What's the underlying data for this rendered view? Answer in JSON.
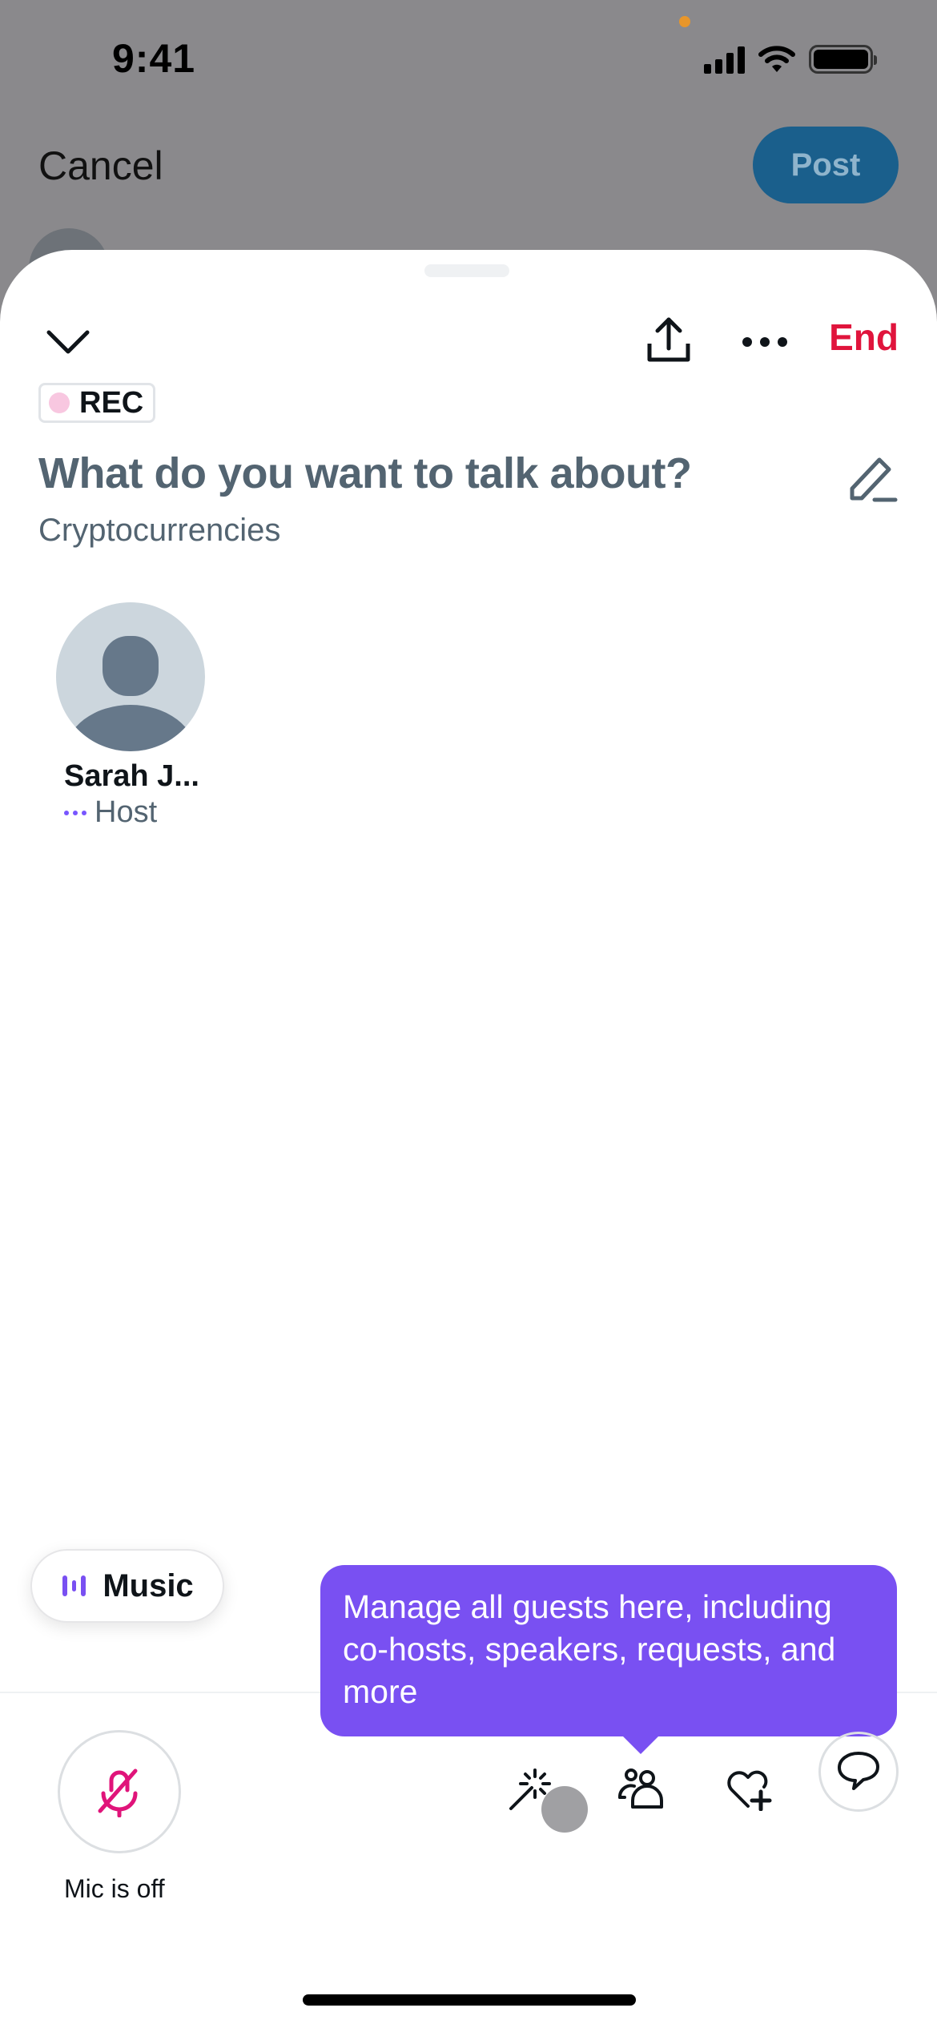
{
  "status_bar": {
    "time": "9:41",
    "icons": [
      "cellular-signal-icon",
      "wifi-icon",
      "battery-icon"
    ]
  },
  "background_screen": {
    "cancel_label": "Cancel",
    "post_label": "Post"
  },
  "space_sheet": {
    "header": {
      "collapse_icon": "chevron-down-icon",
      "share_icon": "share-icon",
      "more_icon": "more-horizontal-icon",
      "end_label": "End"
    },
    "rec_badge": "REC",
    "title": "What do you want to talk about?",
    "topic": "Cryptocurrencies",
    "edit_icon": "pencil-icon",
    "speakers": [
      {
        "name": "Sarah J...",
        "role": "Host"
      }
    ],
    "music_label": "Music",
    "tooltip": "Manage all guests here, including co-hosts, speakers, requests, and more",
    "bottom_bar": {
      "mic_label": "Mic is off",
      "mic_icon": "mic-off-icon",
      "actions": [
        "magic-wand-icon",
        "people-icon",
        "heart-plus-icon",
        "chat-bubble-icon"
      ]
    }
  },
  "colors": {
    "accent_purple": "#7950f2",
    "end_red": "#e0143c",
    "mic_off_pink": "#e0147a",
    "post_blue": "#1a5f8c"
  }
}
